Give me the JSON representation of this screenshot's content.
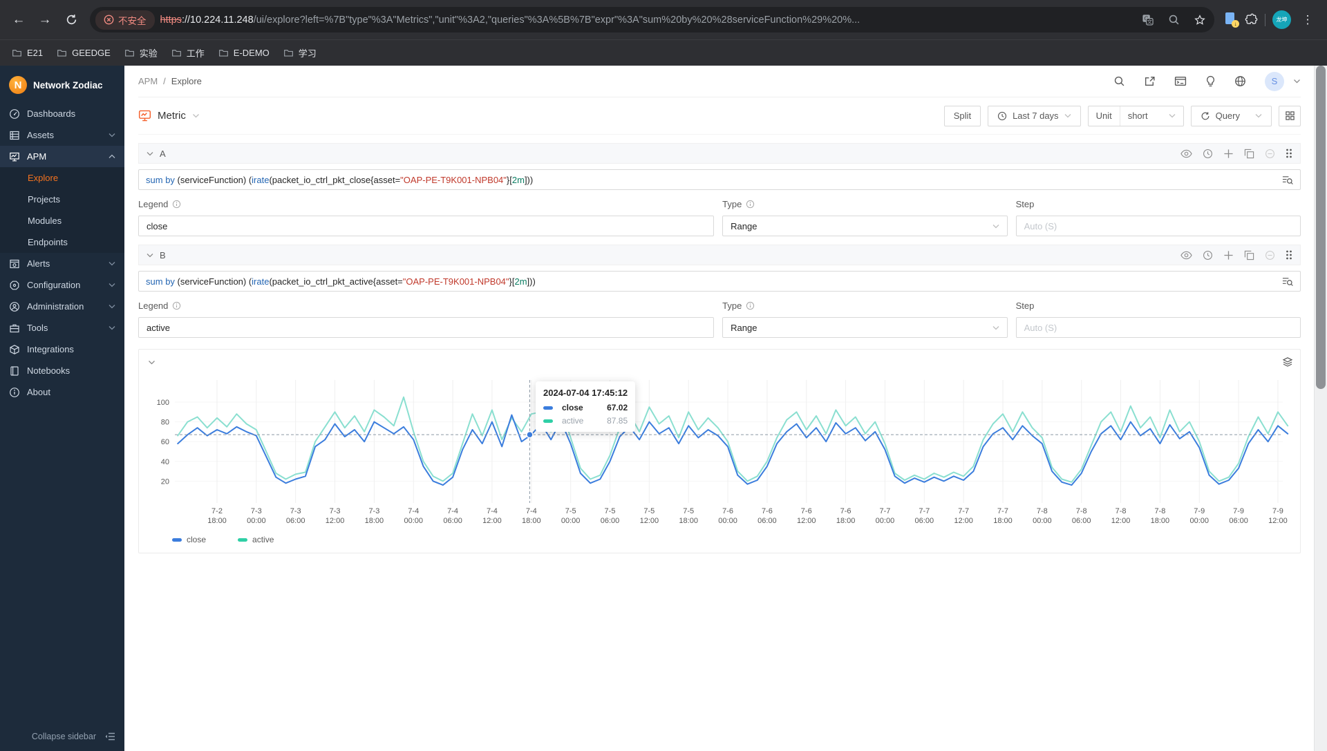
{
  "browser": {
    "security_badge": "不安全",
    "url_scheme": "https",
    "url_domain": "://10.224.11.248",
    "url_path": "/ui/explore?left=%7B\"type\"%3A\"Metrics\",\"unit\"%3A2,\"queries\"%3A%5B%7B\"expr\"%3A\"sum%20by%20%28serviceFunction%29%20%...",
    "avatar_text": "龙坤",
    "bookmarks": [
      "E21",
      "GEEDGE",
      "实验",
      "工作",
      "E-DEMO",
      "学习"
    ]
  },
  "sidebar": {
    "brand": "Network Zodiac",
    "logo_letter": "N",
    "items": [
      {
        "label": "Dashboards"
      },
      {
        "label": "Assets"
      },
      {
        "label": "APM"
      },
      {
        "label": "Alerts"
      },
      {
        "label": "Configuration"
      },
      {
        "label": "Administration"
      },
      {
        "label": "Tools"
      },
      {
        "label": "Integrations"
      },
      {
        "label": "Notebooks"
      },
      {
        "label": "About"
      }
    ],
    "apm_children": [
      {
        "label": "Explore"
      },
      {
        "label": "Projects"
      },
      {
        "label": "Modules"
      },
      {
        "label": "Endpoints"
      }
    ],
    "collapse_label": "Collapse sidebar"
  },
  "header": {
    "breadcrumb": [
      "APM",
      "Explore"
    ],
    "separator": "/",
    "profile_initial": "S"
  },
  "toolbar": {
    "metric_label": "Metric",
    "split_label": "Split",
    "time_range": "Last 7 days",
    "unit_label": "Unit",
    "unit_value": "short",
    "query_label": "Query"
  },
  "sections": [
    {
      "id": "A",
      "expr": "sum by (serviceFunction) (irate(packet_io_ctrl_pkt_close{asset=\"OAP-PE-T9K001-NPB04\"}[2m]))",
      "legend_label": "Legend",
      "legend_value": "close",
      "type_label": "Type",
      "type_value": "Range",
      "step_label": "Step",
      "step_placeholder": "Auto  (S)"
    },
    {
      "id": "B",
      "expr": "sum by (serviceFunction) (irate(packet_io_ctrl_pkt_active{asset=\"OAP-PE-T9K001-NPB04\"}[2m]))",
      "legend_label": "Legend",
      "legend_value": "active",
      "type_label": "Type",
      "type_value": "Range",
      "step_label": "Step",
      "step_placeholder": "Auto  (S)"
    }
  ],
  "chart_data": {
    "type": "line",
    "start_hour": 0,
    "step_hours": 1.5,
    "ylim": [
      0,
      110
    ],
    "yticks": [
      20,
      40,
      60,
      80,
      100
    ],
    "grid": true,
    "legend_position": "bottom-left",
    "xticks": [
      {
        "t": 6,
        "d": "7-2",
        "h": "18:00"
      },
      {
        "t": 12,
        "d": "7-3",
        "h": "00:00"
      },
      {
        "t": 18,
        "d": "7-3",
        "h": "06:00"
      },
      {
        "t": 24,
        "d": "7-3",
        "h": "12:00"
      },
      {
        "t": 30,
        "d": "7-3",
        "h": "18:00"
      },
      {
        "t": 36,
        "d": "7-4",
        "h": "00:00"
      },
      {
        "t": 42,
        "d": "7-4",
        "h": "06:00"
      },
      {
        "t": 48,
        "d": "7-4",
        "h": "12:00"
      },
      {
        "t": 54,
        "d": "7-4",
        "h": "18:00"
      },
      {
        "t": 60,
        "d": "7-5",
        "h": "00:00"
      },
      {
        "t": 66,
        "d": "7-5",
        "h": "06:00"
      },
      {
        "t": 72,
        "d": "7-5",
        "h": "12:00"
      },
      {
        "t": 78,
        "d": "7-5",
        "h": "18:00"
      },
      {
        "t": 84,
        "d": "7-6",
        "h": "00:00"
      },
      {
        "t": 90,
        "d": "7-6",
        "h": "06:00"
      },
      {
        "t": 96,
        "d": "7-6",
        "h": "12:00"
      },
      {
        "t": 102,
        "d": "7-6",
        "h": "18:00"
      },
      {
        "t": 108,
        "d": "7-7",
        "h": "00:00"
      },
      {
        "t": 114,
        "d": "7-7",
        "h": "06:00"
      },
      {
        "t": 120,
        "d": "7-7",
        "h": "12:00"
      },
      {
        "t": 126,
        "d": "7-7",
        "h": "18:00"
      },
      {
        "t": 132,
        "d": "7-8",
        "h": "00:00"
      },
      {
        "t": 138,
        "d": "7-8",
        "h": "06:00"
      },
      {
        "t": 144,
        "d": "7-8",
        "h": "12:00"
      },
      {
        "t": 150,
        "d": "7-8",
        "h": "18:00"
      },
      {
        "t": 156,
        "d": "7-9",
        "h": "00:00"
      },
      {
        "t": 162,
        "d": "7-9",
        "h": "06:00"
      },
      {
        "t": 168,
        "d": "7-9",
        "h": "12:00"
      }
    ],
    "series": [
      {
        "name": "close",
        "color": "#3b7ddd",
        "swatch": "#3b7ddd",
        "values": [
          58,
          67,
          74,
          66,
          72,
          68,
          75,
          70,
          66,
          45,
          24,
          18,
          22,
          25,
          55,
          62,
          78,
          65,
          72,
          60,
          80,
          74,
          68,
          75,
          62,
          35,
          20,
          16,
          24,
          52,
          72,
          58,
          80,
          55,
          87,
          60,
          67,
          78,
          62,
          81,
          58,
          28,
          18,
          22,
          40,
          65,
          75,
          62,
          80,
          68,
          74,
          58,
          76,
          64,
          72,
          66,
          55,
          26,
          17,
          21,
          35,
          58,
          70,
          78,
          64,
          74,
          60,
          79,
          68,
          74,
          61,
          70,
          52,
          25,
          18,
          23,
          19,
          24,
          20,
          25,
          21,
          30,
          55,
          68,
          74,
          62,
          76,
          66,
          58,
          30,
          19,
          16,
          28,
          50,
          68,
          76,
          62,
          80,
          66,
          73,
          58,
          77,
          63,
          70,
          54,
          26,
          17,
          21,
          33,
          58,
          72,
          60,
          76,
          68
        ]
      },
      {
        "name": "active",
        "color": "#8adfd0",
        "swatch": "#2fcfa6",
        "values": [
          66,
          80,
          85,
          74,
          84,
          75,
          88,
          78,
          72,
          50,
          28,
          22,
          27,
          29,
          60,
          75,
          90,
          74,
          86,
          70,
          92,
          85,
          76,
          105,
          70,
          40,
          25,
          20,
          28,
          58,
          88,
          66,
          92,
          62,
          84,
          70,
          88,
          90,
          70,
          95,
          64,
          33,
          22,
          26,
          46,
          74,
          88,
          70,
          95,
          78,
          86,
          64,
          90,
          72,
          84,
          74,
          60,
          30,
          20,
          25,
          40,
          64,
          82,
          90,
          72,
          86,
          68,
          92,
          76,
          85,
          68,
          80,
          58,
          28,
          21,
          26,
          22,
          28,
          24,
          29,
          25,
          35,
          62,
          78,
          88,
          70,
          90,
          74,
          64,
          34,
          22,
          19,
          32,
          56,
          80,
          90,
          70,
          96,
          74,
          85,
          64,
          92,
          70,
          80,
          60,
          30,
          20,
          24,
          38,
          65,
          85,
          68,
          90,
          76
        ]
      }
    ],
    "crosshair": {
      "t": 53.75,
      "value": 67.02
    },
    "tooltip": {
      "title": "2024-07-04 17:45:12",
      "rows": [
        {
          "name": "close",
          "value": "67.02"
        },
        {
          "name": "active",
          "value": "87.85"
        }
      ]
    }
  }
}
